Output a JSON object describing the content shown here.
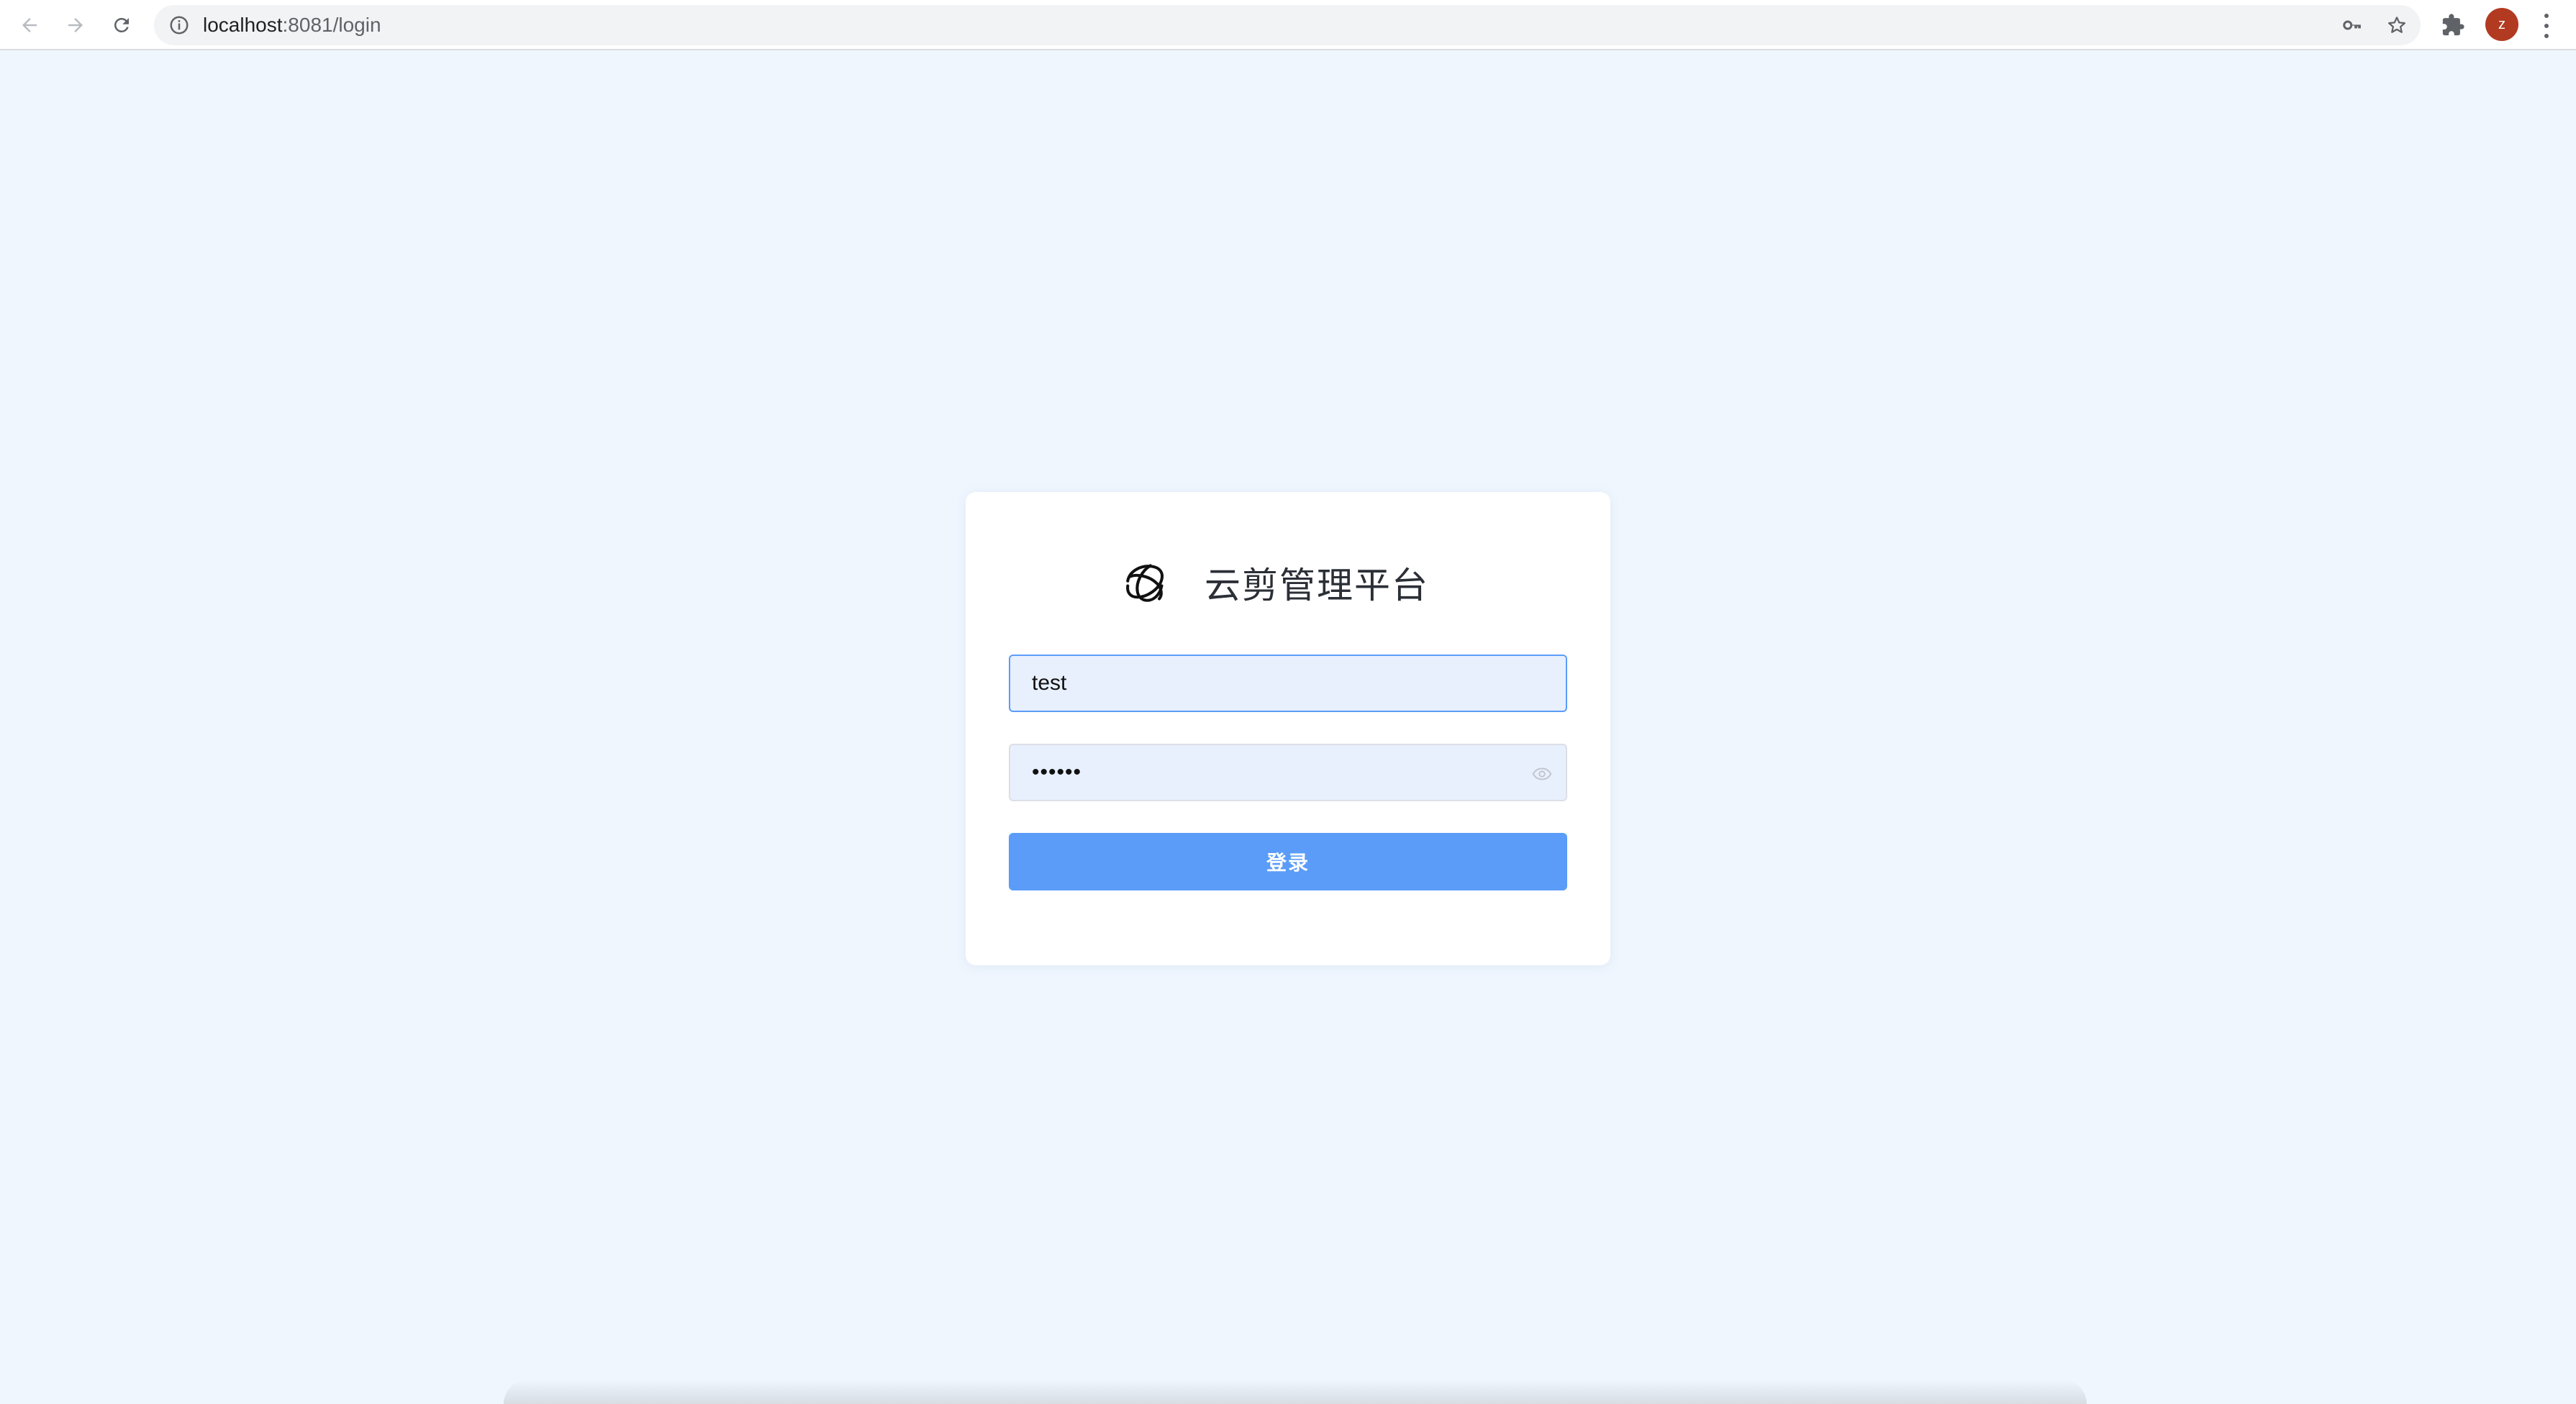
{
  "browser": {
    "url_host": "localhost",
    "url_path": ":8081/login",
    "profile_initial": "z"
  },
  "login": {
    "title": "云剪管理平台",
    "username_value": "test",
    "password_value": "••••••",
    "submit_label": "登录"
  },
  "colors": {
    "page_bg": "#eff6fe",
    "primary": "#5a9cf8",
    "input_bg": "#e8f0fe",
    "focus_border": "#5b9cf8",
    "avatar": "#b23a21"
  },
  "icons": {
    "back": "arrow-left-icon",
    "forward": "arrow-right-icon",
    "reload": "reload-icon",
    "site_info": "info-icon",
    "passwords": "key-icon",
    "bookmark": "star-icon",
    "extensions": "puzzle-icon",
    "menu": "kebab-menu-icon",
    "logo": "knot-logo-icon",
    "show_password": "eye-icon"
  }
}
